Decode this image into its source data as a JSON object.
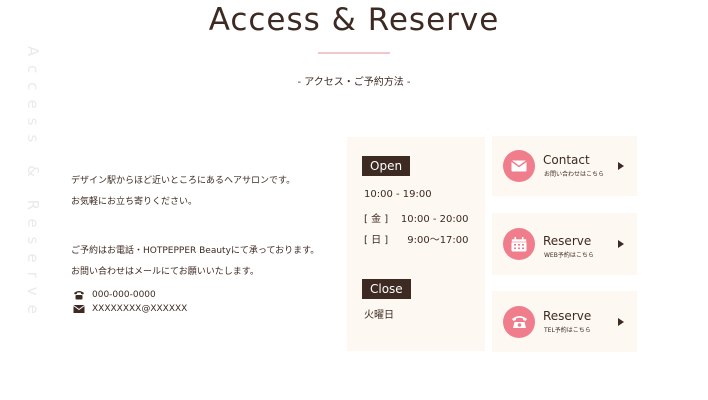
{
  "vertical_deco": "Access & Reserve",
  "title": "Access & Reserve",
  "subtitle": "- アクセス・ご予約方法 -",
  "intro": {
    "line1": "デザイン駅からほど近いところにあるヘアサロンです。",
    "line2": "お気軽にお立ち寄りください。",
    "line3": "ご予約はお電話・HOTPEPPER Beautyにて承っております。",
    "line4": "お問い合わせはメールにてお願いいたします。"
  },
  "contact": {
    "phone": "000-000-0000",
    "email": "XXXXXXXX@XXXXXX"
  },
  "hours": {
    "open_label": "Open",
    "open_lines": [
      "10:00 - 19:00",
      "[ 金 ]    10:00 - 20:00",
      "[ 日 ]      9:00〜17:00"
    ],
    "close_label": "Close",
    "close_day": "火曜日"
  },
  "actions": [
    {
      "title": "Contact",
      "sub": "お問い合わせはこちら",
      "icon": "mail-icon"
    },
    {
      "title": "Reserve",
      "sub": "WEB予約はこちら",
      "icon": "calendar-icon"
    },
    {
      "title": "Reserve",
      "sub": "TEL予約はこちら",
      "icon": "telephone-icon"
    }
  ],
  "colors": {
    "text": "#3d2a22",
    "accent_pink": "#f07d8b",
    "panel_bg": "#fdf8f1",
    "rule_pink": "#f0c8cc"
  }
}
